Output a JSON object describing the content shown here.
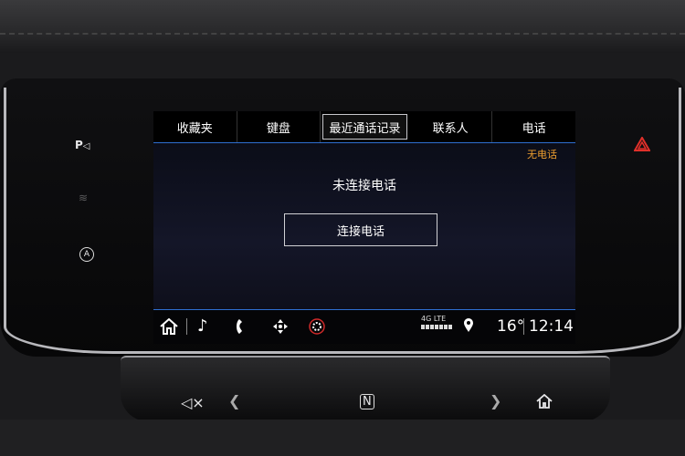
{
  "tabs": [
    {
      "label": "收藏夹"
    },
    {
      "label": "键盘"
    },
    {
      "label": "最近通话记录",
      "active": true
    },
    {
      "label": "联系人"
    },
    {
      "label": "电话"
    }
  ],
  "status": {
    "no_phone": "无电话"
  },
  "main": {
    "message": "未连接电话",
    "connect_button": "连接电话"
  },
  "bottom_bar": {
    "network": "4G LTE",
    "temperature": "16°",
    "time": "12:14"
  },
  "side": {
    "parking_label": "P",
    "auto_label": "A"
  },
  "colors": {
    "accent_blue": "#2f6fd0",
    "warning_orange": "#f0a030",
    "hazard_red": "#e0302a"
  }
}
